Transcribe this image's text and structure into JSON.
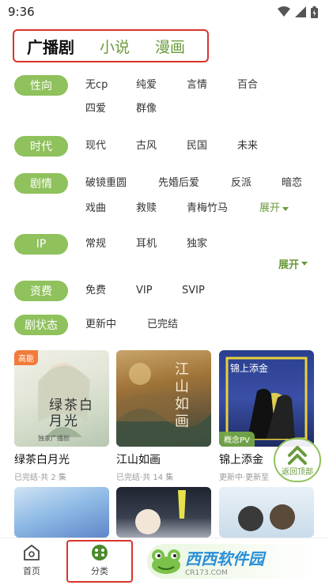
{
  "status": {
    "time": "9:36"
  },
  "tabs": [
    {
      "label": "广播剧"
    },
    {
      "label": "小说"
    },
    {
      "label": "漫画"
    }
  ],
  "filters": {
    "orientation": {
      "label": "性向",
      "options": [
        "无cp",
        "纯爱",
        "言情",
        "百合",
        "四爱",
        "群像"
      ]
    },
    "era": {
      "label": "时代",
      "options": [
        "现代",
        "古风",
        "民国",
        "未来"
      ]
    },
    "plot": {
      "label": "剧情",
      "options": [
        "破镜重圆",
        "先婚后爱",
        "反派",
        "暗恋",
        "戏曲",
        "救赎",
        "青梅竹马"
      ],
      "expand": "展开"
    },
    "ip": {
      "label": "IP",
      "options": [
        "常规",
        "耳机",
        "独家"
      ],
      "expand": "展开"
    },
    "fee": {
      "label": "资费",
      "options": [
        "免费",
        "VIP",
        "SVIP"
      ]
    },
    "status": {
      "label": "剧状态",
      "options": [
        "更新中",
        "已完结"
      ]
    }
  },
  "cards": [
    {
      "title": "绿茶白月光",
      "meta": "已完结·共 2 集",
      "badge": "高能",
      "cover_text": "绿茶白月光",
      "cover_sub": "独家广播剧"
    },
    {
      "title": "江山如画",
      "meta": "已完结·共 14 集",
      "cover_text": "江山如画"
    },
    {
      "title": "锦上添金",
      "meta": "更新中·更新至",
      "badge": "概念PV",
      "cover_text": "锦上添金"
    }
  ],
  "back_to_top": "返回顶部",
  "bottom_nav": [
    {
      "label": "首页"
    },
    {
      "label": "分类"
    }
  ],
  "watermark": {
    "main": "西西软件园",
    "sub": "CR173.COM"
  },
  "colors": {
    "accent": "#8fc15c",
    "accent_text": "#6a9a3c",
    "highlight_box": "#d9342b",
    "badge": "#f27b3a"
  }
}
